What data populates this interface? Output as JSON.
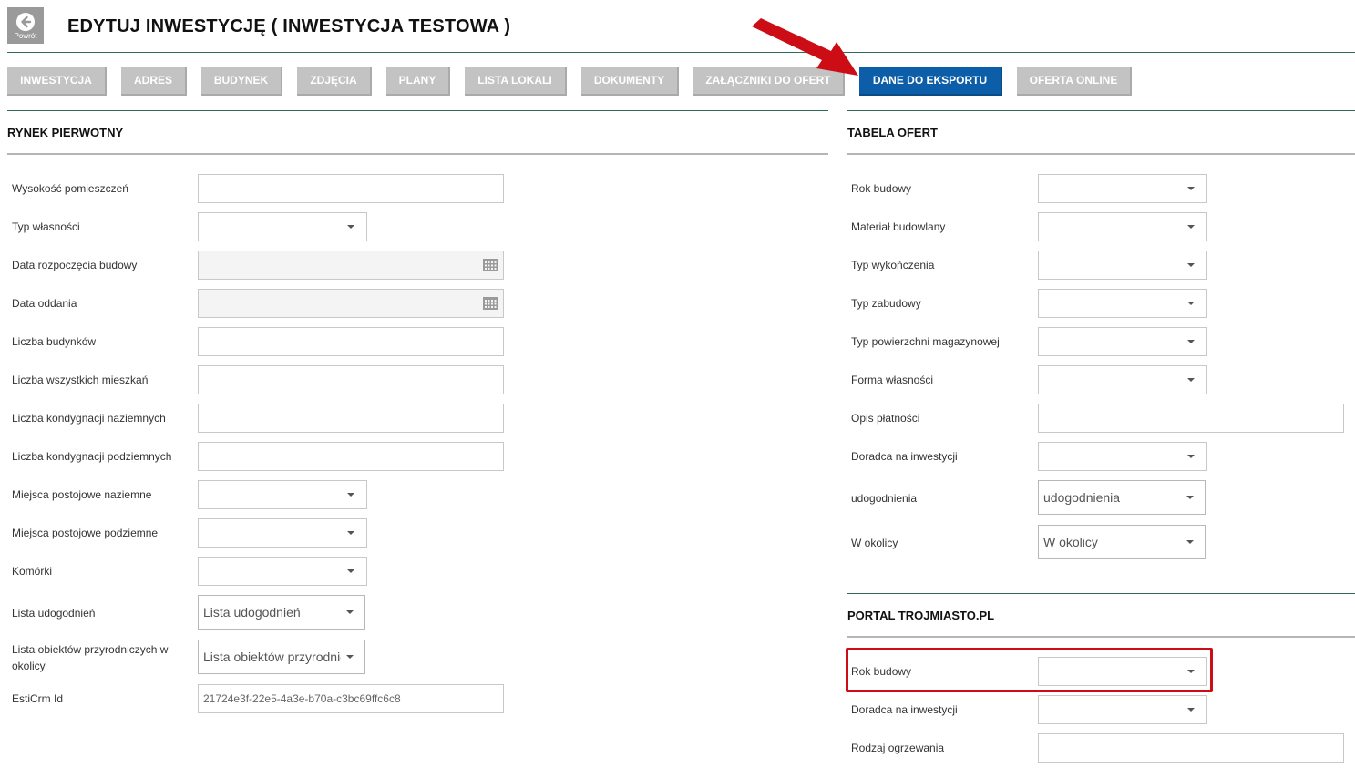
{
  "header": {
    "back_label": "Powrót",
    "title": "EDYTUJ INWESTYCJĘ ( INWESTYCJA TESTOWA )"
  },
  "tabs": [
    {
      "label": "INWESTYCJA"
    },
    {
      "label": "ADRES"
    },
    {
      "label": "BUDYNEK"
    },
    {
      "label": "ZDJĘCIA"
    },
    {
      "label": "PLANY"
    },
    {
      "label": "LISTA LOKALI"
    },
    {
      "label": "DOKUMENTY"
    },
    {
      "label": "ZAŁĄCZNIKI DO OFERT"
    },
    {
      "label": "DANE DO EKSPORTU",
      "active": true
    },
    {
      "label": "OFERTA ONLINE"
    }
  ],
  "rynek": {
    "title": "RYNEK PIERWOTNY",
    "fields": [
      {
        "label": "Wysokość pomieszczeń"
      },
      {
        "label": "Typ własności"
      },
      {
        "label": "Data rozpoczęcia budowy"
      },
      {
        "label": "Data oddania"
      },
      {
        "label": "Liczba budynków"
      },
      {
        "label": "Liczba wszystkich mieszkań"
      },
      {
        "label": "Liczba kondygnacji naziemnych"
      },
      {
        "label": "Liczba kondygnacji podziemnych"
      },
      {
        "label": "Miejsca postojowe naziemne"
      },
      {
        "label": "Miejsca postojowe podziemne"
      },
      {
        "label": "Komórki"
      },
      {
        "label": "Lista udogodnień",
        "placeholder": "Lista udogodnień"
      },
      {
        "label_line1": "Lista obiektów przyrodniczych w",
        "label_line2": "okolicy",
        "placeholder": "Lista obiektów przyrodnic"
      },
      {
        "label": "EstiCrm Id",
        "value": "21724e3f-22e5-4a3e-b70a-c3bc69ffc6c8"
      }
    ]
  },
  "tabela": {
    "title": "TABELA OFERT",
    "fields": [
      {
        "label": "Rok budowy"
      },
      {
        "label": "Materiał budowlany"
      },
      {
        "label": "Typ wykończenia"
      },
      {
        "label": "Typ zabudowy"
      },
      {
        "label": "Typ powierzchni magazynowej"
      },
      {
        "label": "Forma własności"
      },
      {
        "label": "Opis płatności"
      },
      {
        "label": "Doradca na inwestycji"
      },
      {
        "label": "udogodnienia",
        "placeholder": "udogodnienia"
      },
      {
        "label": "W okolicy",
        "placeholder": "W okolicy"
      }
    ]
  },
  "portal": {
    "title": "PORTAL TROJMIASTO.PL",
    "fields": [
      {
        "label": "Rok budowy"
      },
      {
        "label": "Doradca na inwestycji"
      },
      {
        "label": "Rodzaj ogrzewania"
      }
    ]
  },
  "colors": {
    "active_tab": "#0d5ea8",
    "inactive_tab": "#c3c3c3",
    "annotation_red": "#cc0d16",
    "header_rule": "#2e6b5a"
  }
}
